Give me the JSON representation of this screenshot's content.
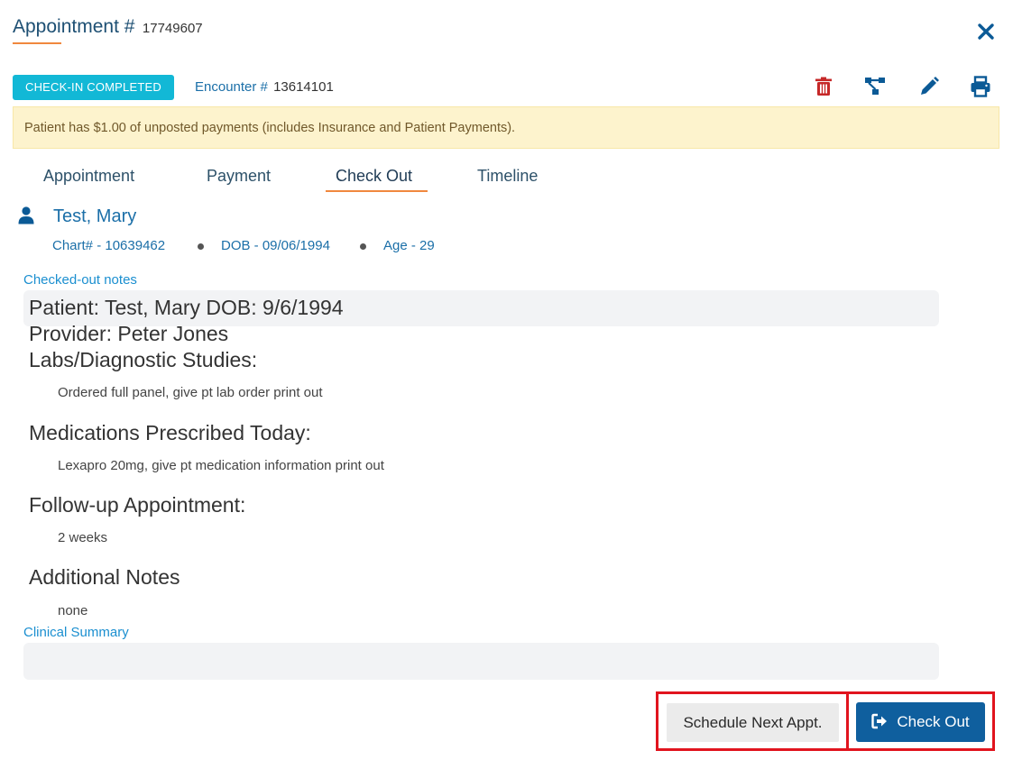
{
  "header": {
    "title_label": "Appointment #",
    "appointment_number": "17749607",
    "close_symbol": "✕"
  },
  "status": {
    "badge": "CHECK-IN COMPLETED",
    "encounter_label": "Encounter #",
    "encounter_number": "13614101"
  },
  "toolbar": {
    "icons": [
      "trash-icon",
      "sitemap-icon",
      "pencil-icon",
      "print-icon"
    ],
    "delete_color": "#c62828",
    "icon_color": "#0b5a96"
  },
  "alert": {
    "text": "Patient has $1.00 of unposted payments (includes Insurance and Patient Payments)."
  },
  "tabs": [
    {
      "label": "Appointment",
      "active": false
    },
    {
      "label": "Payment",
      "active": false
    },
    {
      "label": "Check Out",
      "active": true
    },
    {
      "label": "Timeline",
      "active": false
    }
  ],
  "patient": {
    "name": "Test, Mary",
    "chart": "Chart# - 10639462",
    "dob": "DOB - 09/06/1994",
    "age": "Age - 29"
  },
  "notes": {
    "label": "Checked-out notes",
    "line1": "Patient: Test, Mary DOB: 9/6/1994",
    "line2": "Provider: Peter Jones",
    "labs_heading": "Labs/Diagnostic Studies:",
    "labs_text": "Ordered full panel, give pt lab order print out",
    "meds_heading": "Medications Prescribed Today:",
    "meds_text": "Lexapro 20mg, give pt medication information print out",
    "followup_heading": "Follow-up Appointment:",
    "followup_text": "2 weeks",
    "additional_heading": "Additional Notes",
    "additional_text": "none"
  },
  "clinical_summary": {
    "label": "Clinical Summary",
    "value": ""
  },
  "footer": {
    "schedule_label": "Schedule Next Appt.",
    "checkout_label": "Check Out"
  },
  "colors": {
    "accent_orange": "#f0883e",
    "badge": "#12b8d6",
    "primary_button": "#0f5f9e",
    "highlight": "#e1141e"
  }
}
